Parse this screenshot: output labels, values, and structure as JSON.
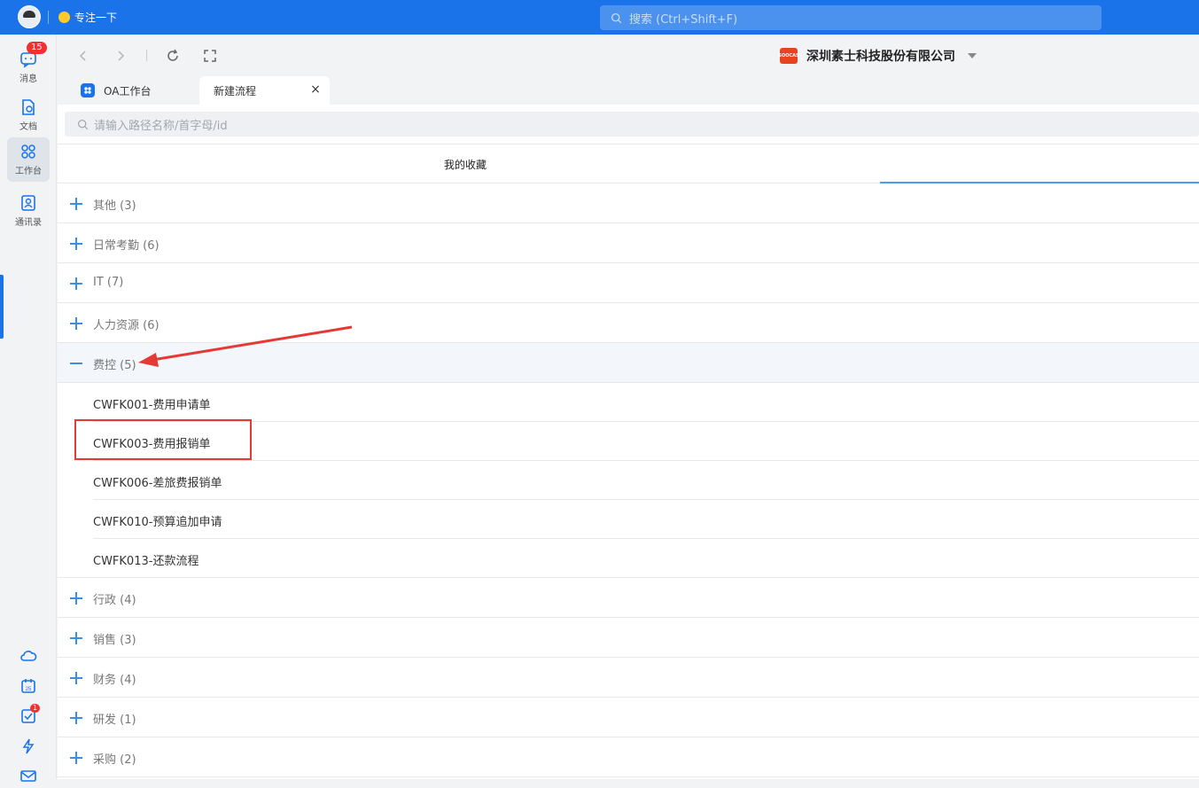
{
  "topbar": {
    "status_text": "专注一下",
    "search_placeholder": "搜索 (Ctrl+Shift+F)"
  },
  "sidebar": {
    "items": [
      {
        "label": "消息",
        "icon": "message-icon",
        "badge": "15"
      },
      {
        "label": "文档",
        "icon": "document-icon"
      },
      {
        "label": "工作台",
        "icon": "workbench-icon"
      },
      {
        "label": "通讯录",
        "icon": "contacts-icon"
      }
    ],
    "bottom_icons": [
      "cloud-icon",
      "calendar-icon",
      "todo-icon",
      "lightning-icon",
      "mail-icon"
    ],
    "calendar_day": "25",
    "todo_badge": "1"
  },
  "header": {
    "company": "深圳素士科技股份有限公司",
    "company_logo_text": "SOOCAS"
  },
  "tabs": [
    {
      "label": "OA工作台"
    },
    {
      "label": "新建流程",
      "active": true
    }
  ],
  "filter": {
    "placeholder": "请输入路径名称/首字母/id"
  },
  "section_title": "我的收藏",
  "groups": [
    {
      "name": "其他 (3)"
    },
    {
      "name": "日常考勤 (6)"
    },
    {
      "name": "IT (7)"
    },
    {
      "name": "人力资源 (6)"
    },
    {
      "name": "费控 (5)",
      "expanded": true,
      "items": [
        "CWFK001-费用申请单",
        "CWFK003-费用报销单",
        "CWFK006-差旅费报销单",
        "CWFK010-预算追加申请",
        "CWFK013-还款流程"
      ]
    },
    {
      "name": "行政 (4)"
    },
    {
      "name": "销售 (3)"
    },
    {
      "name": "财务 (4)"
    },
    {
      "name": "研发 (1)"
    },
    {
      "name": "采购 (2)"
    }
  ],
  "colors": {
    "topbar": "#1a73e8",
    "accent": "#3a8ee6",
    "annotation": "#e53935"
  }
}
